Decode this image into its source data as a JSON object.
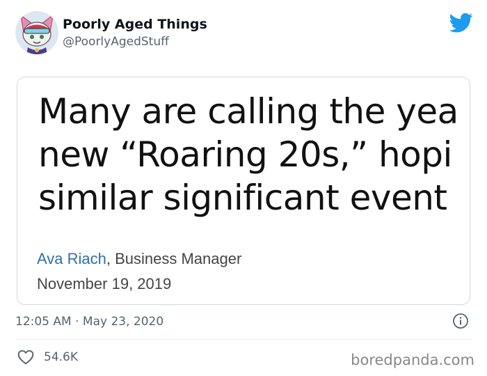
{
  "tweet": {
    "display_name": "Poorly Aged Things",
    "handle": "@PoorlyAgedStuff",
    "timestamp": "12:05 AM · May 23, 2020",
    "like_count": "54.6K"
  },
  "image": {
    "quote_lines": [
      "Many are calling the yea",
      "new “Roaring 20s,” hopi",
      "similar significant event"
    ],
    "author": "Ava Riach",
    "author_role": ", Business Manager",
    "date": "November 19, 2019"
  },
  "watermark": "boredpanda.com",
  "icons": {
    "brand": "twitter-bird-icon",
    "info": "info-icon",
    "like": "heart-icon"
  },
  "colors": {
    "twitter_blue": "#1d9bf0",
    "link_blue": "#2f6fa6",
    "secondary_text": "#536471"
  }
}
